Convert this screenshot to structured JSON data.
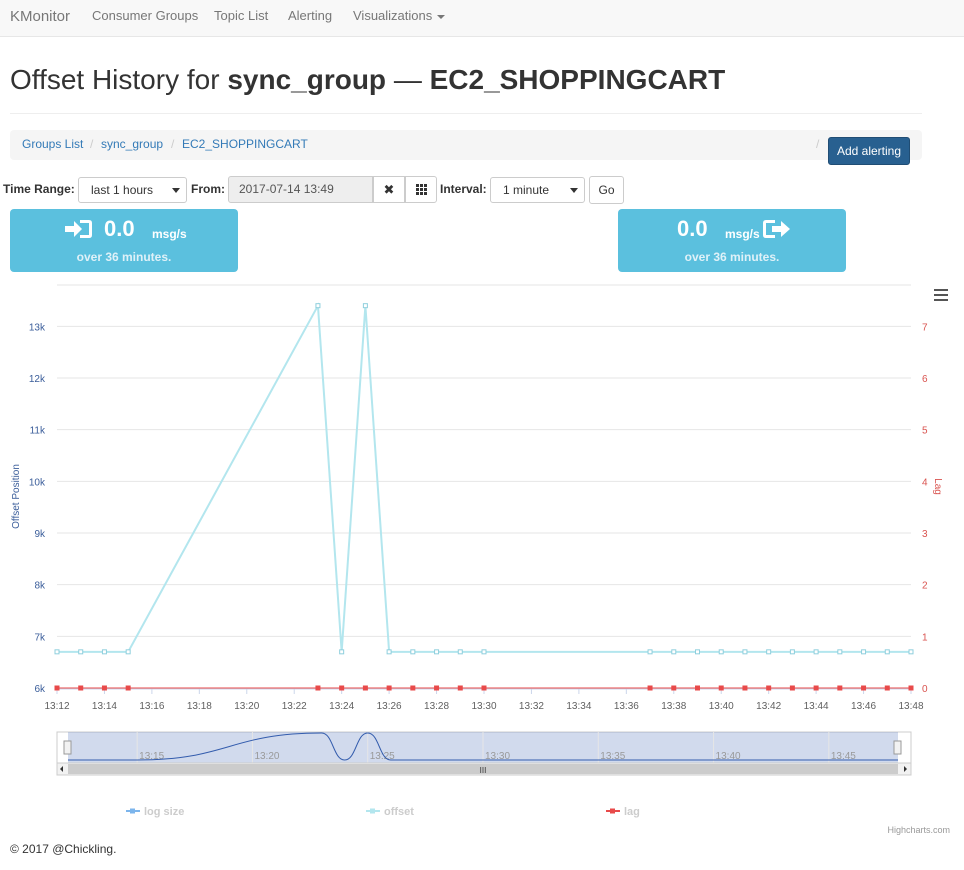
{
  "navbar": {
    "brand": "KMonitor",
    "items": [
      "Consumer Groups",
      "Topic List",
      "Alerting",
      "Visualizations"
    ]
  },
  "header": {
    "prefix": "Offset History for",
    "group": "sync_group",
    "dash": "—",
    "topic": "EC2_SHOPPINGCART"
  },
  "breadcrumb": [
    "Groups List",
    "sync_group",
    "EC2_SHOPPINGCART"
  ],
  "breadcrumb_sep": "/",
  "add_alerting": "Add alerting",
  "toolbar": {
    "time_range_label": "Time Range:",
    "time_range_value": "last 1 hours",
    "from_label": "From:",
    "from_value": "2017-07-14 13:49",
    "clear_glyph": "✖",
    "interval_label": "Interval:",
    "interval_value": "1 minute",
    "go_label": "Go"
  },
  "rates": {
    "in": {
      "value": "0.0",
      "unit": "msg/s",
      "sub": "over 36 minutes.",
      "icon": "sign-in-icon"
    },
    "out": {
      "value": "0.0",
      "unit": "msg/s",
      "sub": "over 36 minutes.",
      "icon": "sign-out-icon"
    }
  },
  "colors": {
    "primary": "#337ab7",
    "info": "#5bc0de",
    "log_size": "#7cb5ec",
    "offset": "#b3e6ee",
    "lag": "#e84a4a",
    "axis_left": "#3a5d9a",
    "axis_right": "#d9534f"
  },
  "chart_data": {
    "type": "line",
    "x": [
      "13:12",
      "13:13",
      "13:14",
      "13:15",
      "13:23",
      "13:24",
      "13:25",
      "13:26",
      "13:27",
      "13:28",
      "13:29",
      "13:30",
      "13:37",
      "13:38",
      "13:39",
      "13:40",
      "13:41",
      "13:42",
      "13:43",
      "13:44",
      "13:45",
      "13:46",
      "13:47",
      "13:48"
    ],
    "x_ticks": [
      "13:12",
      "13:14",
      "13:16",
      "13:18",
      "13:20",
      "13:22",
      "13:24",
      "13:26",
      "13:28",
      "13:30",
      "13:32",
      "13:34",
      "13:36",
      "13:38",
      "13:40",
      "13:42",
      "13:44",
      "13:46",
      "13:48"
    ],
    "xlim": [
      "13:12",
      "13:48"
    ],
    "ylabel_left": "Offset Position",
    "ylabel_right": "Lag",
    "y_left_ticks": [
      "6k",
      "7k",
      "8k",
      "9k",
      "10k",
      "11k",
      "12k",
      "13k"
    ],
    "y_right_ticks": [
      "0",
      "1",
      "2",
      "3",
      "4",
      "5",
      "6",
      "7"
    ],
    "ylim_left": [
      6000,
      13800
    ],
    "ylim_right": [
      0,
      7.8
    ],
    "series": [
      {
        "name": "log size",
        "axis": "left",
        "values": [
          6700,
          6700,
          6700,
          6700,
          13400,
          6700,
          13400,
          6700,
          6700,
          6700,
          6700,
          6700,
          6700,
          6700,
          6700,
          6700,
          6700,
          6700,
          6700,
          6700,
          6700,
          6700,
          6700,
          6700
        ]
      },
      {
        "name": "offset",
        "axis": "left",
        "values": [
          6700,
          6700,
          6700,
          6700,
          13400,
          6700,
          13400,
          6700,
          6700,
          6700,
          6700,
          6700,
          6700,
          6700,
          6700,
          6700,
          6700,
          6700,
          6700,
          6700,
          6700,
          6700,
          6700,
          6700
        ]
      },
      {
        "name": "lag",
        "axis": "right",
        "values": [
          0,
          0,
          0,
          0,
          0,
          0,
          0,
          0,
          0,
          0,
          0,
          0,
          0,
          0,
          0,
          0,
          0,
          0,
          0,
          0,
          0,
          0,
          0,
          0
        ]
      }
    ],
    "navigator_ticks": [
      "13:15",
      "13:20",
      "13:25",
      "13:30",
      "13:35",
      "13:40",
      "13:45"
    ],
    "legend": [
      "log size",
      "offset",
      "lag"
    ],
    "credits": "Highcharts.com",
    "grid": true,
    "legend_position": "bottom"
  },
  "footer": "© 2017 @Chickling."
}
